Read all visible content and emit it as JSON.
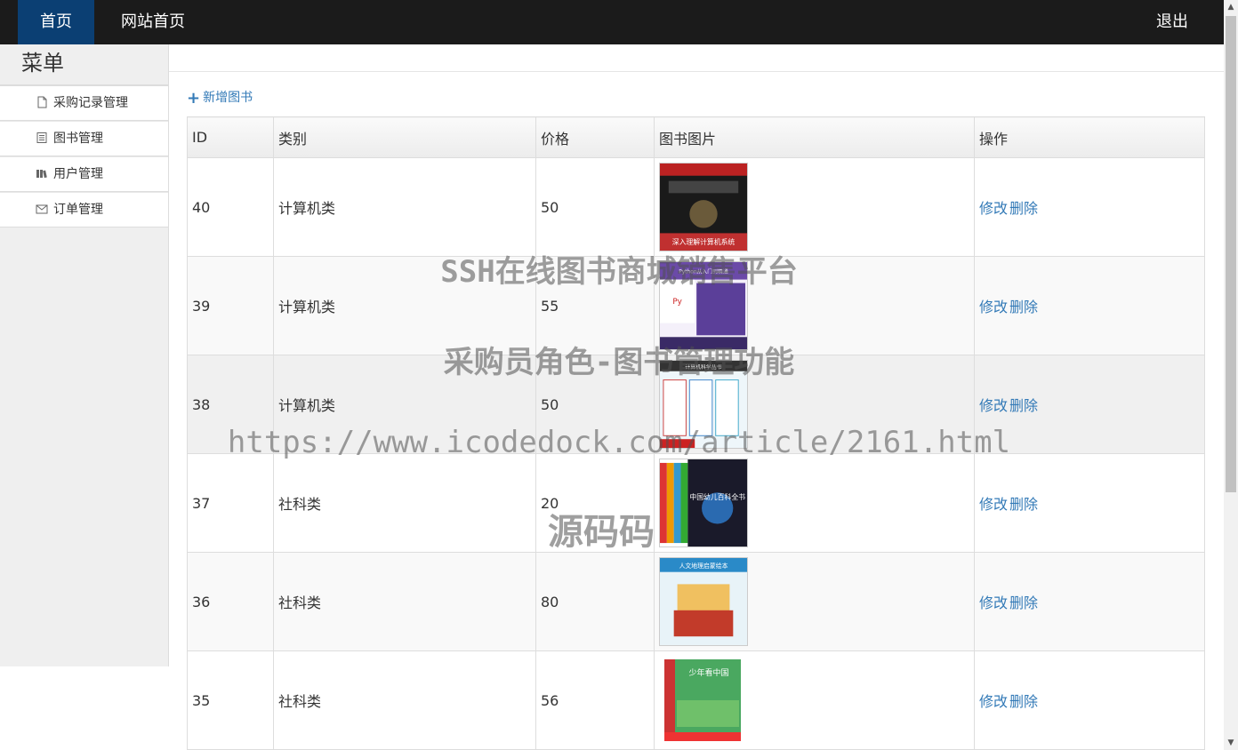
{
  "topbar": {
    "home_label": "首页",
    "site_label": "网站首页",
    "logout_label": "退出"
  },
  "sidebar": {
    "title": "菜单",
    "items": [
      {
        "label": "采购记录管理",
        "icon": "file-icon"
      },
      {
        "label": "图书管理",
        "icon": "list-icon"
      },
      {
        "label": "用户管理",
        "icon": "books-icon"
      },
      {
        "label": "订单管理",
        "icon": "envelope-icon"
      }
    ]
  },
  "toolbar": {
    "add_label": "新增图书"
  },
  "table": {
    "headers": [
      "ID",
      "类别",
      "价格",
      "图书图片",
      "操作"
    ],
    "rows": [
      {
        "id": "40",
        "category": "计算机类",
        "price": "50",
        "cover": "深入理解计算机系统",
        "edit": "修改",
        "delete": "删除"
      },
      {
        "id": "39",
        "category": "计算机类",
        "price": "55",
        "cover": "Python从入门到精通",
        "edit": "修改",
        "delete": "删除"
      },
      {
        "id": "38",
        "category": "计算机类",
        "price": "50",
        "cover": "计算机科学丛书",
        "edit": "修改",
        "delete": "删除"
      },
      {
        "id": "37",
        "category": "社科类",
        "price": "20",
        "cover": "中国幼儿百科全书",
        "edit": "修改",
        "delete": "删除"
      },
      {
        "id": "36",
        "category": "社科类",
        "price": "80",
        "cover": "人文地理启蒙绘本",
        "edit": "修改",
        "delete": "删除"
      },
      {
        "id": "35",
        "category": "社科类",
        "price": "56",
        "cover": "少年看中国",
        "edit": "修改",
        "delete": "删除"
      }
    ]
  },
  "watermark": {
    "line1": "SSH在线图书商城销售平台",
    "line2": "采购员角色-图书管理功能",
    "line3": "https://www.icodedock.com/article/2161.html",
    "line4": "源码码"
  },
  "colors": {
    "topbar": "#1b1b1b",
    "active_nav": "#0b3f73",
    "link": "#337ab7"
  }
}
